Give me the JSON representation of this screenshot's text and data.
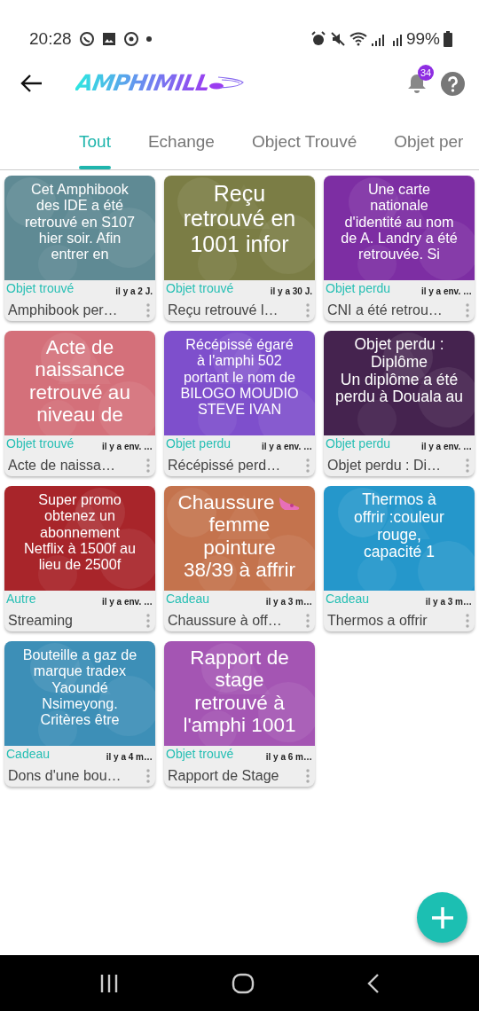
{
  "status_bar": {
    "time": "20:28",
    "battery": "99%"
  },
  "app_bar": {
    "logo": "AMPHIMILL",
    "notification_count": "34"
  },
  "tabs": [
    {
      "label": "Tout",
      "selected": true
    },
    {
      "label": "Echange",
      "selected": false
    },
    {
      "label": "Object Trouvé",
      "selected": false
    },
    {
      "label": "Objet per",
      "selected": false
    }
  ],
  "posts": [
    {
      "lines": [
        "Cet Amphibook",
        "des IDE a été",
        "retrouvé en S107",
        "hier soir. Afin",
        "entrer en"
      ],
      "color": "#5f8a94",
      "category": "Objet trouvé",
      "time": "il y a 2 J.",
      "title": "Amphibook per…"
    },
    {
      "lines": [
        "Reçu",
        "retrouvé en",
        "1001 infor"
      ],
      "color": "#7b7d45",
      "category": "Objet trouvé",
      "time": "il y a 30 J.",
      "title": "Reçu retrouvé l…"
    },
    {
      "lines": [
        "Une carte",
        "nationale",
        "d'identité au nom",
        "de A. Landry a été",
        "retrouvée. Si"
      ],
      "color": "#7d2ea3",
      "category": "Objet perdu",
      "time": "il y a env. …",
      "title": "CNI a été retrou…"
    },
    {
      "lines": [
        "Acte de",
        "naissance",
        "retrouvé au",
        "niveau de"
      ],
      "color": "#d4707a",
      "category": "Objet trouvé",
      "time": "il y a env. …",
      "title": "Acte de naissa…"
    },
    {
      "lines": [
        "Récépissé égaré",
        "à l'amphi 502",
        "portant le nom de",
        "BILOGO MOUDIO",
        "STEVE IVAN"
      ],
      "color": "#7e4fcc",
      "category": "Objet perdu",
      "time": "il y a env. …",
      "title": "Récépissé perd…"
    },
    {
      "lines": [
        "Objet perdu :",
        "Diplôme",
        "Un diplôme  a été",
        "perdu à Douala au"
      ],
      "color": "#45234f",
      "category": "Objet perdu",
      "time": "il y a env. …",
      "title": "Objet perdu : Di…"
    },
    {
      "lines": [
        "Super promo",
        "obtenez un",
        "abonnement",
        "Netflix à 1500f au",
        "lieu de 2500f"
      ],
      "color": "#a8252a",
      "category": "Autre",
      "time": "il y a env. …",
      "title": "Streaming"
    },
    {
      "lines": [
        "Chaussure",
        "femme",
        "pointure",
        "38/39 à affrir"
      ],
      "color": "#c4734d",
      "category": "Cadeau",
      "time": "il y a 3 m…",
      "title": "Chaussure à off…",
      "trailing_icon": true
    },
    {
      "lines": [
        "Thermos à",
        "offrir :couleur",
        "rouge,",
        "capacité 1"
      ],
      "color": "#2597cb",
      "category": "Cadeau",
      "time": "il y a 3 m…",
      "title": "Thermos a offrir"
    },
    {
      "lines": [
        "Bouteille a gaz de",
        "marque tradex",
        "Yaoundé",
        "Nsimeyong.",
        "Critères être"
      ],
      "color": "#3d8fb7",
      "category": "Cadeau",
      "time": "il y a 4 m…",
      "title": "Dons d'une bou…"
    },
    {
      "lines": [
        "Rapport de",
        "stage",
        "retrouvé à",
        "l'amphi 1001"
      ],
      "color": "#a455b3",
      "category": "Objet trouvé",
      "time": "il y a 6 m…",
      "title": "Rapport de Stage"
    }
  ]
}
